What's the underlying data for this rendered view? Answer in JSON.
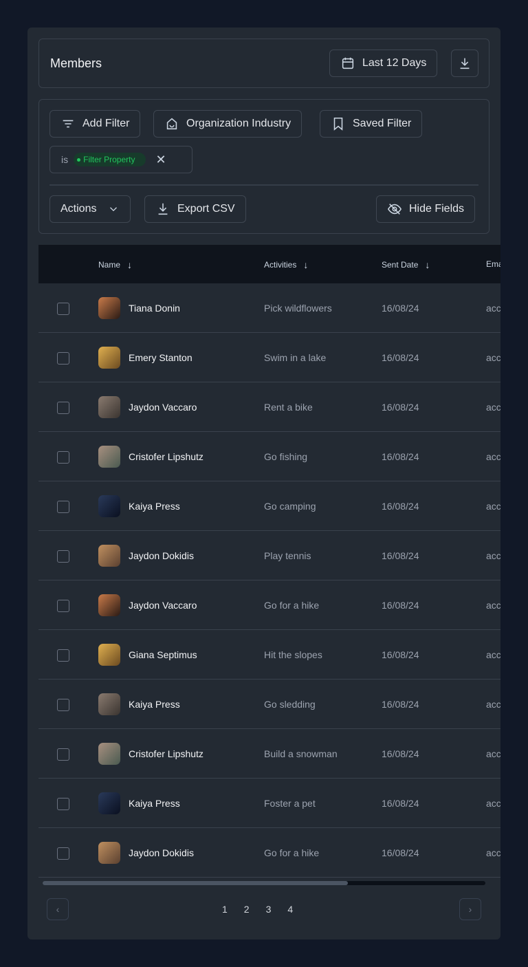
{
  "header": {
    "title": "Members",
    "date_range": "Last 12 Days"
  },
  "filters": {
    "add_filter": "Add Filter",
    "org_industry": "Organization Industry",
    "saved_filter": "Saved Filter",
    "condition_op": "is",
    "condition_value": "Filter Property"
  },
  "toolbar": {
    "actions": "Actions",
    "export": "Export CSV",
    "hide_fields": "Hide Fields"
  },
  "table": {
    "columns": [
      "Name",
      "Activities",
      "Sent Date",
      "Email"
    ],
    "rows": [
      {
        "name": "Tiana Donin",
        "activity": "Pick wildflowers",
        "date": "16/08/24",
        "email": "acc"
      },
      {
        "name": "Emery Stanton",
        "activity": "Swim in a lake",
        "date": "16/08/24",
        "email": "acc"
      },
      {
        "name": "Jaydon Vaccaro",
        "activity": "Rent a bike",
        "date": "16/08/24",
        "email": "acc"
      },
      {
        "name": "Cristofer Lipshutz",
        "activity": "Go fishing",
        "date": "16/08/24",
        "email": "acc"
      },
      {
        "name": "Kaiya Press",
        "activity": "Go camping",
        "date": "16/08/24",
        "email": "acc"
      },
      {
        "name": "Jaydon Dokidis",
        "activity": "Play tennis",
        "date": "16/08/24",
        "email": "acc"
      },
      {
        "name": "Jaydon Vaccaro",
        "activity": "Go for a hike",
        "date": "16/08/24",
        "email": "acc"
      },
      {
        "name": "Giana Septimus",
        "activity": "Hit the slopes",
        "date": "16/08/24",
        "email": "acc"
      },
      {
        "name": "Kaiya Press",
        "activity": "Go sledding",
        "date": "16/08/24",
        "email": "acc"
      },
      {
        "name": "Cristofer Lipshutz",
        "activity": "Build a snowman",
        "date": "16/08/24",
        "email": "acc"
      },
      {
        "name": "Kaiya Press",
        "activity": "Foster a pet",
        "date": "16/08/24",
        "email": "acc"
      },
      {
        "name": "Jaydon Dokidis",
        "activity": "Go for a hike",
        "date": "16/08/24",
        "email": "acc"
      }
    ],
    "horizontal_scroll_fraction": 0.69
  },
  "pagination": {
    "pages": [
      "1",
      "2",
      "3",
      "4"
    ],
    "prev": "‹",
    "next": "›"
  },
  "colors": {
    "background": "#111827",
    "panel": "#232a33",
    "accent_green": "#22c55e"
  }
}
